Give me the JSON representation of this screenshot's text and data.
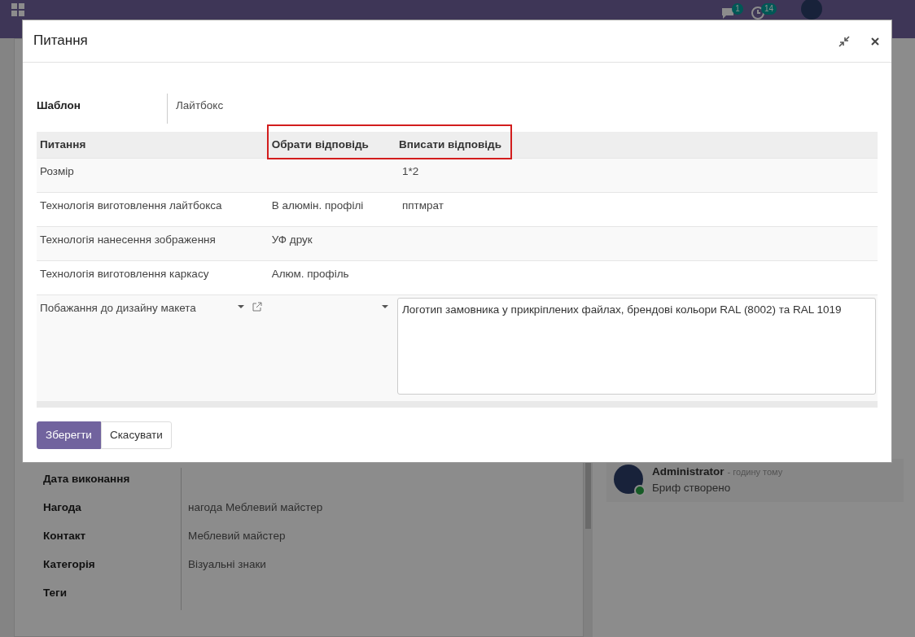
{
  "navbar": {
    "message_count": "1",
    "activity_count": "14"
  },
  "form": {
    "fields": [
      {
        "label": "Дата виконання"
      },
      {
        "label": "Нагода",
        "value": "нагода Меблевий майстер"
      },
      {
        "label": "Контакт",
        "value": "Меблевий майстер"
      },
      {
        "label": "Категорія",
        "value": "Візуальні знаки"
      },
      {
        "label": "Теги"
      }
    ]
  },
  "chatter": {
    "author": "Administrator",
    "time": "- годину тому",
    "message": "Бриф створено"
  },
  "dialog": {
    "title": "Питання",
    "template_label": "Шаблон",
    "template_value": "Лайтбокс",
    "table": {
      "columns": [
        {
          "label": "Питання",
          "highlighted": false
        },
        {
          "label": "Обрати відповідь",
          "highlighted": true
        },
        {
          "label": "Вписати відповідь",
          "highlighted": true
        }
      ],
      "rows": [
        {
          "kind": "text",
          "question": "Розмір",
          "answer": "1*2"
        },
        {
          "kind": "text",
          "question": "Технологія виготовлення лайтбокса",
          "choice": "В алюмін. профілі",
          "answer": "пптмрат"
        },
        {
          "kind": "text",
          "question": "Технологія нанесення зображення",
          "choice": "УФ друк"
        },
        {
          "kind": "text",
          "question": "Технологія виготовлення каркасу",
          "choice": "Алюм. профіль"
        },
        {
          "kind": "edit",
          "question": "Побажання до дизайну макета",
          "answer": "Логотип замовника у прикріплених файлах, брендові кольори RAL (8002) та RAL 1019"
        }
      ]
    },
    "buttons": [
      {
        "label": "Зберегти",
        "kind": "primary"
      },
      {
        "label": "Скасувати",
        "kind": "secondary"
      }
    ]
  }
}
